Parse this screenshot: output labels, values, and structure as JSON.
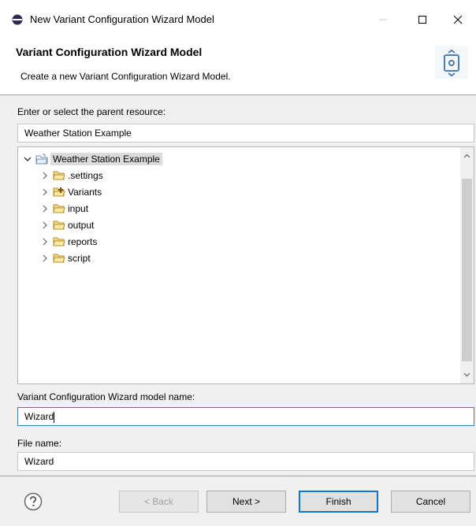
{
  "window": {
    "title": "New Variant Configuration Wizard Model",
    "minimize_icon": "minimize-icon",
    "maximize_icon": "maximize-icon",
    "close_icon": "close-icon"
  },
  "header": {
    "title": "Variant Configuration Wizard Model",
    "description": "Create a new Variant Configuration Wizard Model."
  },
  "parent": {
    "label": "Enter or select the parent resource:",
    "value": "Weather Station Example"
  },
  "tree": {
    "root": "Weather Station Example",
    "children": [
      ".settings",
      "Variants",
      "input",
      "output",
      "reports",
      "script"
    ]
  },
  "model_name": {
    "label": "Variant Configuration Wizard model name:",
    "value": "Wizard"
  },
  "file_name": {
    "label": "File name:",
    "value": "Wizard"
  },
  "buttons": {
    "back": "< Back",
    "next": "Next >",
    "finish": "Finish",
    "cancel": "Cancel"
  },
  "colors": {
    "accent": "#0078d7",
    "folder": "#e8b84a"
  }
}
